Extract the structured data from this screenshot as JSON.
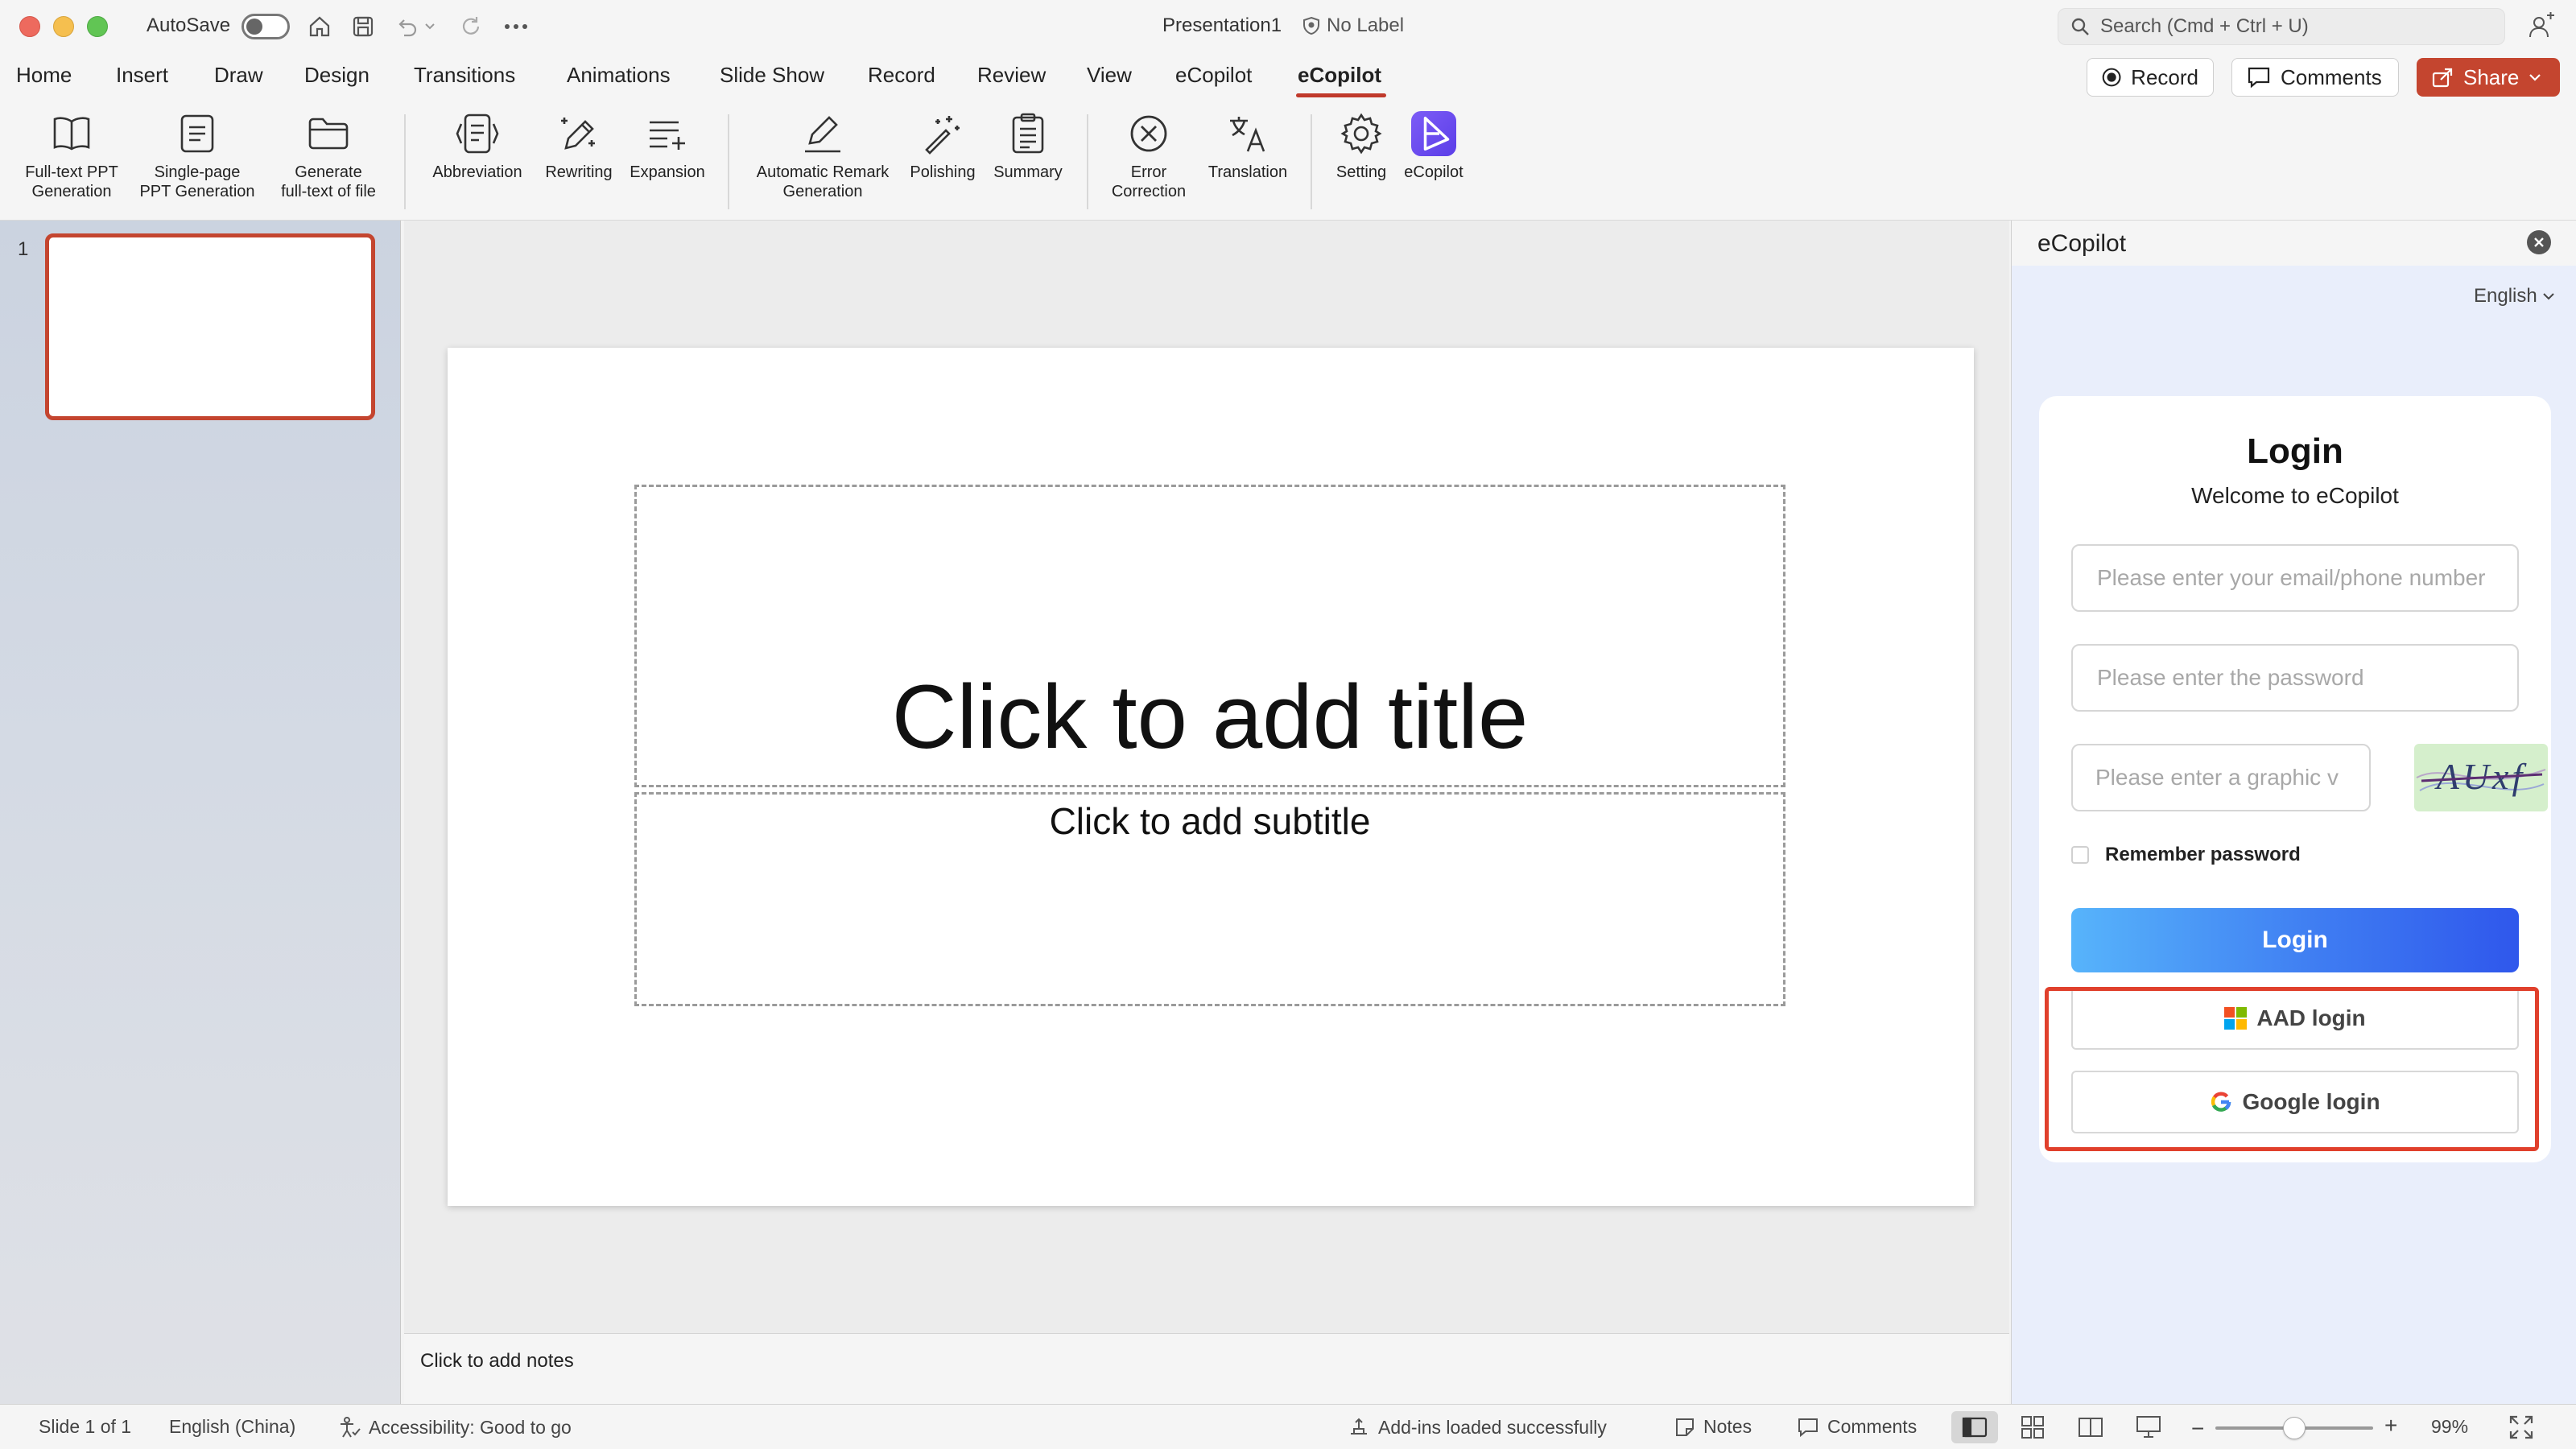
{
  "titlebar": {
    "autosave_label": "AutoSave",
    "document_title": "Presentation1",
    "sensitivity_label": "No Label",
    "search_placeholder": "Search (Cmd + Ctrl + U)"
  },
  "menu": {
    "tabs": [
      {
        "label": "Home"
      },
      {
        "label": "Insert"
      },
      {
        "label": "Draw"
      },
      {
        "label": "Design"
      },
      {
        "label": "Transitions"
      },
      {
        "label": "Animations"
      },
      {
        "label": "Slide Show"
      },
      {
        "label": "Record"
      },
      {
        "label": "Review"
      },
      {
        "label": "View"
      },
      {
        "label": "eCopilot"
      },
      {
        "label": "eCopilot"
      }
    ],
    "active_index": 11,
    "record_label": "Record",
    "comments_label": "Comments",
    "share_label": "Share"
  },
  "ribbon": {
    "buttons": [
      {
        "line1": "Full-text PPT",
        "line2": "Generation",
        "icon": "book-icon"
      },
      {
        "line1": "Single-page",
        "line2": "PPT Generation",
        "icon": "page-icon"
      },
      {
        "line1": "Generate",
        "line2": "full-text of file",
        "icon": "folder-icon"
      },
      {
        "line1": "Abbreviation",
        "line2": "",
        "icon": "abbreviation-icon"
      },
      {
        "line1": "Rewriting",
        "line2": "",
        "icon": "pencil-sparkle-icon"
      },
      {
        "line1": "Expansion",
        "line2": "",
        "icon": "list-plus-icon"
      },
      {
        "line1": "Automatic Remark",
        "line2": "Generation",
        "icon": "pen-line-icon"
      },
      {
        "line1": "Polishing",
        "line2": "",
        "icon": "magic-wand-icon"
      },
      {
        "line1": "Summary",
        "line2": "",
        "icon": "clipboard-icon"
      },
      {
        "line1": "Error",
        "line2": "Correction",
        "icon": "x-circle-icon"
      },
      {
        "line1": "Translation",
        "line2": "",
        "icon": "translate-icon"
      },
      {
        "line1": "Setting",
        "line2": "",
        "icon": "gear-icon"
      },
      {
        "line1": "eCopilot",
        "line2": "",
        "icon": "ecopilot-logo-icon"
      }
    ]
  },
  "thumbnails": {
    "slide_number": "1"
  },
  "slide": {
    "title_placeholder": "Click to add title",
    "subtitle_placeholder": "Click to add subtitle"
  },
  "notes": {
    "placeholder": "Click to add notes"
  },
  "panel": {
    "title": "eCopilot",
    "language": "English",
    "login": {
      "title": "Login",
      "subtitle": "Welcome to eCopilot",
      "email_placeholder": "Please enter your email/phone number",
      "password_placeholder": "Please enter the password",
      "captcha_placeholder": "Please enter a graphic v",
      "captcha_text": "AUxf",
      "remember_label": "Remember password",
      "login_button": "Login",
      "aad_button": "AAD login",
      "google_button": "Google login"
    }
  },
  "statusbar": {
    "slide_info": "Slide 1 of 1",
    "language": "English (China)",
    "accessibility": "Accessibility: Good to go",
    "addins": "Add-ins loaded successfully",
    "notes": "Notes",
    "comments": "Comments",
    "zoom": "99%",
    "zoom_minus": "−",
    "zoom_plus": "+"
  },
  "colors": {
    "accent": "#c4452f",
    "login_gradient_start": "#57b4fb",
    "login_gradient_end": "#2f57ec",
    "highlight": "#e0402c"
  }
}
